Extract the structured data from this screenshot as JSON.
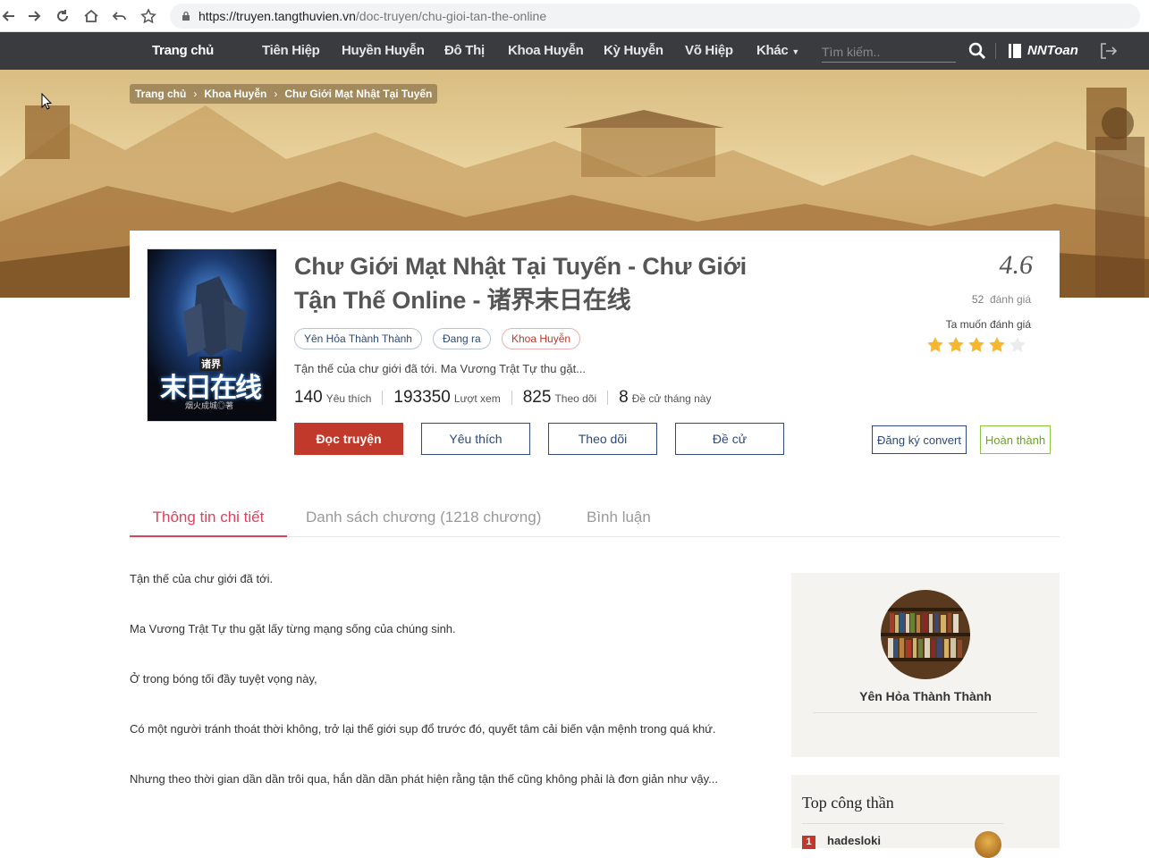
{
  "browser": {
    "url_host": "https://truyen.tangthuvien.vn",
    "url_path": "/doc-truyen/chu-gioi-tan-the-online"
  },
  "nav": {
    "home": "Trang chủ",
    "items": [
      "Tiên Hiệp",
      "Huyền Huyễn",
      "Đô Thị",
      "Khoa Huyễn",
      "Kỳ Huyễn",
      "Võ Hiệp",
      "Khác"
    ],
    "search_placeholder": "Tìm kiếm..",
    "user": "NNToan"
  },
  "breadcrumb": [
    "Trang chủ",
    "Khoa Huyễn",
    "Chư Giới Mạt Nhật Tại Tuyến"
  ],
  "book": {
    "title": "Chư Giới Mạt Nhật Tại Tuyến - Chư Giới Tận Thế Online - 诸界末日在线",
    "author": "Yên Hỏa Thành Thành",
    "status": "Đang ra",
    "category": "Khoa Huyễn",
    "intro": "Tận thế của chư giới đã tới. Ma Vương Trật Tự thu gặt...",
    "cover_text": "末日在线",
    "cover_top": "诸界",
    "cover_author": "烟火成城◎著",
    "stats": [
      {
        "value": "140",
        "label": "Yêu thích"
      },
      {
        "value": "193350",
        "label": "Lượt xem"
      },
      {
        "value": "825",
        "label": "Theo dõi"
      },
      {
        "value": "8",
        "label": "Đề cử tháng này"
      }
    ],
    "buttons": {
      "read": "Đọc truyện",
      "like": "Yêu thích",
      "follow": "Theo dõi",
      "nominate": "Đề cử",
      "convert": "Đăng ký convert",
      "complete": "Hoàn thành"
    },
    "rating": {
      "score": "4.6",
      "count": "52",
      "count_label": "đánh giá",
      "prompt": "Ta muốn đánh giá",
      "stars_filled": 4,
      "stars_total": 5
    }
  },
  "tabs": [
    "Thông tin chi tiết",
    "Danh sách chương (1218 chương)",
    "Bình luận"
  ],
  "description": [
    "Tận thế của chư giới đã tới.",
    "Ma Vương Trật Tự thu gặt lấy từng mạng sống của chúng sinh.",
    "Ở trong bóng tối đầy tuyệt vọng này,",
    "Có một người tránh thoát thời không, trở lại thế giới sụp đổ trước đó, quyết tâm cải biến vận mệnh trong quá khứ.",
    "Nhưng theo thời gian dần dần trôi qua, hắn dần dần phát hiện rằng tận thế cũng không phải là đơn giản như vậy..."
  ],
  "sidebar": {
    "author_name": "Yên Hỏa Thành Thành",
    "top_title": "Top công thần",
    "top": [
      {
        "rank": "1",
        "name": "hadesloki"
      }
    ]
  },
  "colors": {
    "nav_bg": "#3a3b3f",
    "accent_red": "#c0392b",
    "tab_active": "#e0405a",
    "link_blue": "#2d4a7a",
    "star": "#f5b72e"
  }
}
